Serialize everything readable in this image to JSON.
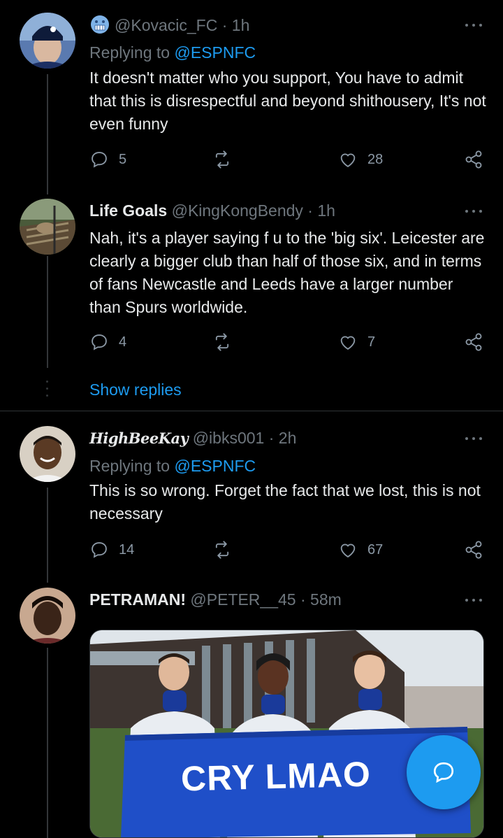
{
  "tweets": [
    {
      "name": "",
      "handle": "@Kovacic_FC",
      "time": "1h",
      "replying_prefix": "Replying to ",
      "replying_to": "@ESPNFC",
      "text": "It doesn't matter who you support, You have to admit that this is disrespectful and beyond shithousery, It's not even funny",
      "replies": "5",
      "retweets": "",
      "likes": "28"
    },
    {
      "name": "Life Goals",
      "handle": "@KingKongBendy",
      "time": "1h",
      "text": "Nah, it's a player saying f u to the 'big six'. Leicester are clearly a bigger club than half of those six, and in terms of fans Newcastle and Leeds have a larger number than Spurs worldwide.",
      "replies": "4",
      "retweets": "",
      "likes": "7"
    },
    {
      "name": "HighBeeKay",
      "handle": "@ibks001",
      "time": "2h",
      "replying_prefix": "Replying to ",
      "replying_to": "@ESPNFC",
      "text": "This is so wrong. Forget the fact that we lost, this is not necessary",
      "replies": "14",
      "retweets": "",
      "likes": "67"
    },
    {
      "name": "PETRAMAN!",
      "handle": "@PETER__45",
      "time": "58m",
      "media_banner_text": "CRY LMAO"
    }
  ],
  "show_replies_label": "Show replies",
  "colors": {
    "background": "#000000",
    "accent": "#1d9bf0",
    "muted": "#6e767d",
    "text": "#e7e9ea"
  },
  "icons": {
    "reply": "reply-icon",
    "retweet": "retweet-icon",
    "like": "heart-icon",
    "share": "share-icon",
    "more": "more-icon",
    "compose": "compose-reply-icon"
  }
}
